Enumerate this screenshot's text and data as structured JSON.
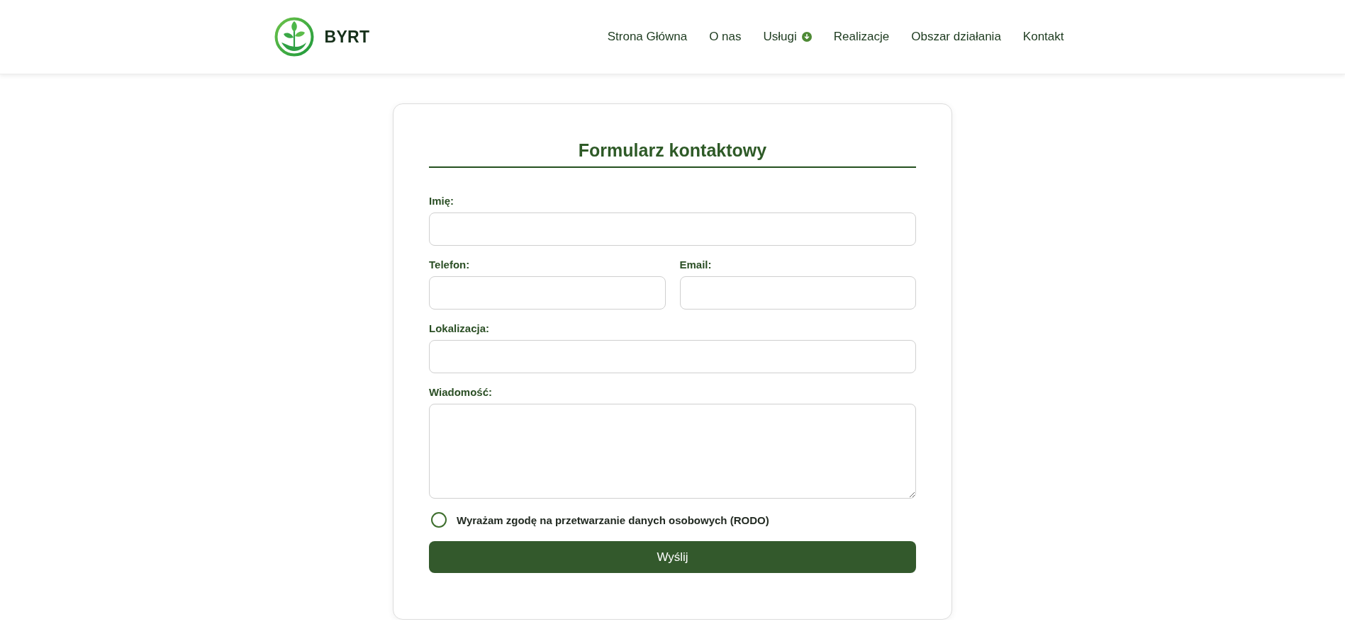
{
  "header": {
    "brand": "BYRT",
    "nav": [
      {
        "label": "Strona Główna",
        "has_dropdown": false
      },
      {
        "label": "O nas",
        "has_dropdown": false
      },
      {
        "label": "Usługi",
        "has_dropdown": true
      },
      {
        "label": "Realizacje",
        "has_dropdown": false
      },
      {
        "label": "Obszar działania",
        "has_dropdown": false
      },
      {
        "label": "Kontakt",
        "has_dropdown": false
      }
    ]
  },
  "form": {
    "title": "Formularz kontaktowy",
    "rows": [
      [
        {
          "label": "Imię:",
          "kind": "input"
        }
      ],
      [
        {
          "label": "Telefon:",
          "kind": "input"
        },
        {
          "label": "Email:",
          "kind": "input"
        }
      ],
      [
        {
          "label": "Lokalizacja:",
          "kind": "input"
        }
      ],
      [
        {
          "label": "Wiadomość:",
          "kind": "textarea"
        }
      ]
    ],
    "consent": {
      "label": "Wyrażam zgodę na przetwarzanie danych osobowych (RODO)",
      "checked": false
    },
    "submit": "Wyślij"
  }
}
